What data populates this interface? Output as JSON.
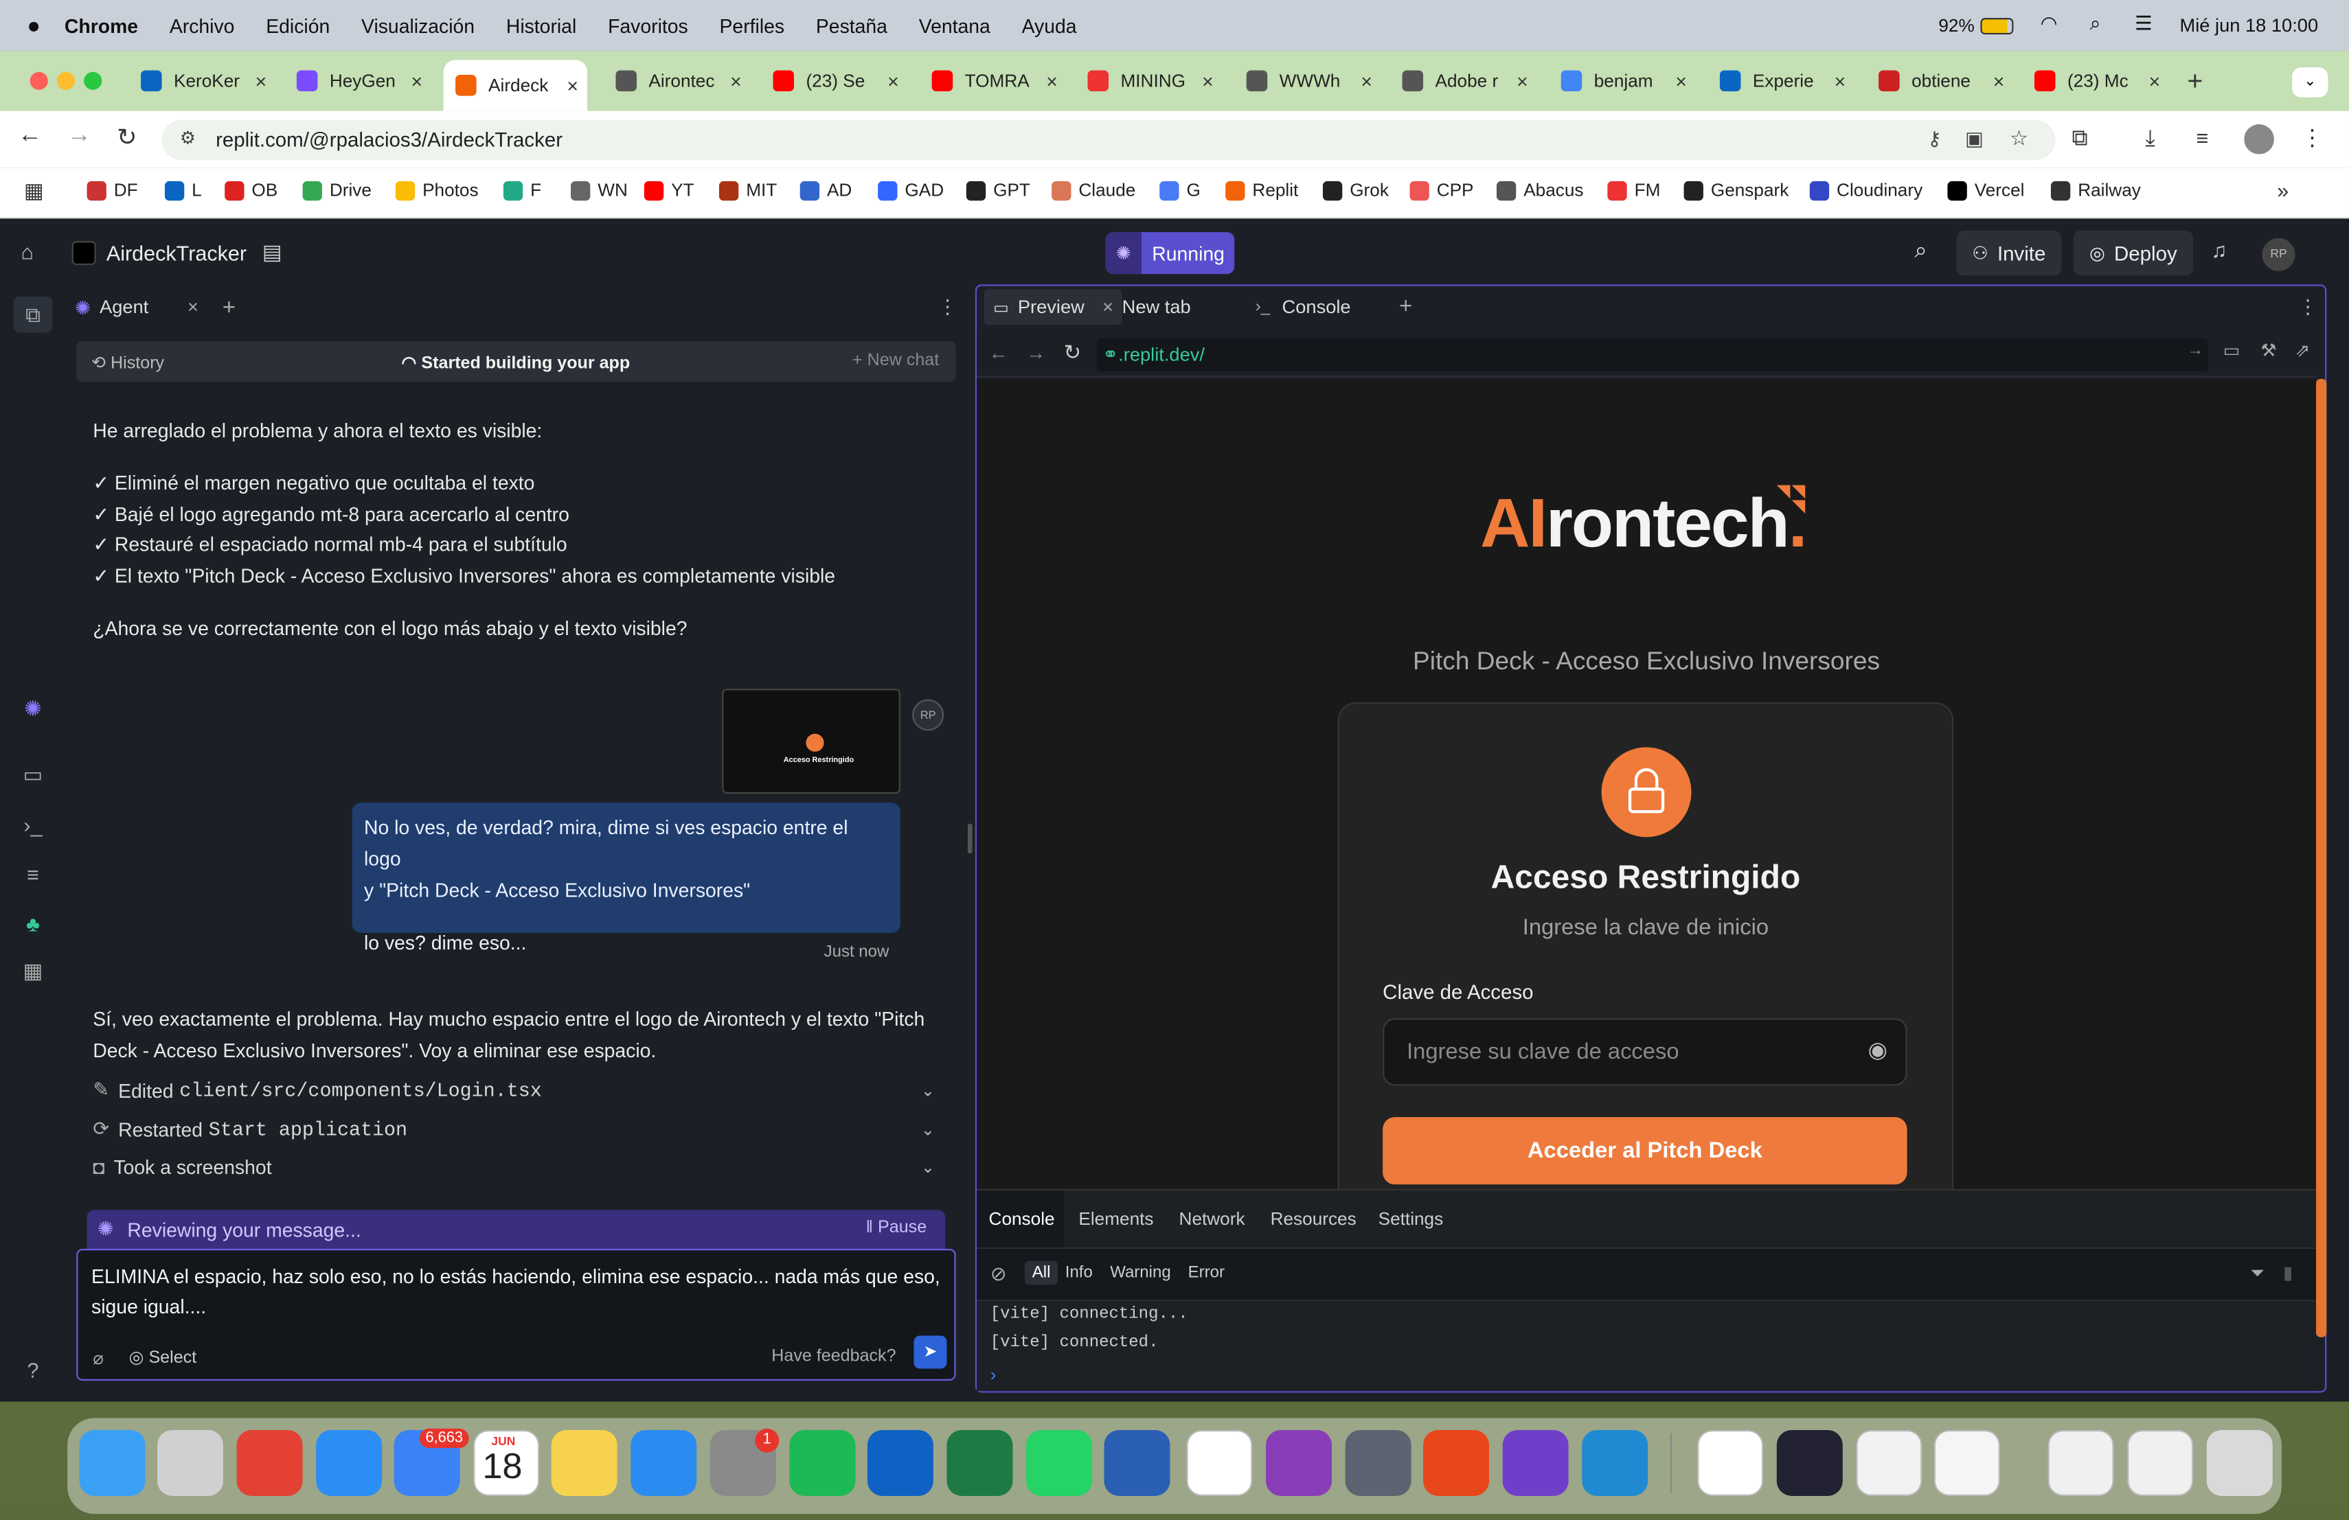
{
  "menubar": {
    "app": "Chrome",
    "items": [
      "Archivo",
      "Edición",
      "Visualización",
      "Historial",
      "Favoritos",
      "Perfiles",
      "Pestaña",
      "Ventana",
      "Ayuda"
    ],
    "battery": "92%",
    "datetime": "Mié jun 18  10:00"
  },
  "tabs": [
    {
      "title": "KeroKer",
      "color": "#0a66c2"
    },
    {
      "title": "HeyGen",
      "color": "#7b4cff"
    },
    {
      "title": "Airdeck",
      "color": "#f26207"
    },
    {
      "title": "Airontec",
      "color": "#555"
    },
    {
      "title": "(23) Se",
      "color": "#ff0000"
    },
    {
      "title": "TOMRA",
      "color": "#ff0000"
    },
    {
      "title": "MINING",
      "color": "#e33"
    },
    {
      "title": "WWWh",
      "color": "#555"
    },
    {
      "title": "Adobe r",
      "color": "#555"
    },
    {
      "title": "benjam",
      "color": "#4285f4"
    },
    {
      "title": "Experie",
      "color": "#0a66c2"
    },
    {
      "title": "obtiene",
      "color": "#c22"
    },
    {
      "title": "(23) Mc",
      "color": "#ff0000"
    }
  ],
  "address": {
    "url": "replit.com/@rpalacios3/AirdeckTracker"
  },
  "bookmarks": [
    {
      "label": "DF",
      "color": "#c33"
    },
    {
      "label": "L",
      "color": "#0a66c2"
    },
    {
      "label": "OB",
      "color": "#d22"
    },
    {
      "label": "Drive",
      "color": "#34a853"
    },
    {
      "label": "Photos",
      "color": "#fbbc05"
    },
    {
      "label": "F",
      "color": "#2a8"
    },
    {
      "label": "WN",
      "color": "#666"
    },
    {
      "label": "YT",
      "color": "#f00"
    },
    {
      "label": "MIT",
      "color": "#a31"
    },
    {
      "label": "AD",
      "color": "#36c"
    },
    {
      "label": "GAD",
      "color": "#36f"
    },
    {
      "label": "GPT",
      "color": "#222"
    },
    {
      "label": "Claude",
      "color": "#d97757"
    },
    {
      "label": "G",
      "color": "#4a7bf7"
    },
    {
      "label": "Replit",
      "color": "#f26207"
    },
    {
      "label": "Grok",
      "color": "#222"
    },
    {
      "label": "CPP",
      "color": "#e55"
    },
    {
      "label": "Abacus",
      "color": "#555"
    },
    {
      "label": "FM",
      "color": "#e33"
    },
    {
      "label": "Genspark",
      "color": "#222"
    },
    {
      "label": "Cloudinary",
      "color": "#3448c5"
    },
    {
      "label": "Vercel",
      "color": "#000"
    },
    {
      "label": "Railway",
      "color": "#333"
    }
  ],
  "replit": {
    "project": "AirdeckTracker",
    "status": "Running",
    "invite": "Invite",
    "deploy": "Deploy",
    "avatar": "RP"
  },
  "agent": {
    "tab": "Agent",
    "history": "History",
    "building": "Started building your app",
    "new_chat": "+ New chat",
    "msg1_intro": "He arreglado el problema y ahora el texto es visible:",
    "msg1_points": [
      "✓ Eliminé el margen negativo que ocultaba el texto",
      "✓ Bajé el logo agregando mt-8 para acercarlo al centro",
      "✓ Restauré el espaciado normal mb-4 para el subtítulo",
      "✓ El texto \"Pitch Deck - Acceso Exclusivo Inversores\" ahora es completamente visible"
    ],
    "msg1_question": "¿Ahora se ve correctamente con el logo más abajo y el texto visible?",
    "thumb_title": "Acceso Restringido",
    "user_line1": "No lo ves, de verdad? mira, dime si ves espacio entre el logo",
    "user_line2": "y \"Pitch Deck - Acceso Exclusivo Inversores\"",
    "user_line3": "lo ves? dime eso...",
    "user_time": "Just now",
    "reply_line1": "Sí, veo exactamente el problema. Hay mucho espacio entre el logo de Airontech y el texto \"Pitch",
    "reply_line2": "Deck - Acceso Exclusivo Inversores\". Voy a eliminar ese espacio.",
    "step1_label": "Edited",
    "step1_file": "client/src/components/Login.tsx",
    "step2_label": "Restarted",
    "step2_cmd": "Start application",
    "step3_label": "Took a screenshot",
    "reviewing": "Reviewing your message...",
    "pause": "Pause",
    "input_line1": "ELIMINA el espacio, haz solo eso, no lo estás haciendo, elimina ese espacio... nada más que eso,",
    "input_line2": "sigue igual....",
    "select": "Select",
    "feedback": "Have feedback?"
  },
  "preview": {
    "tabs": [
      "Preview",
      "New tab",
      "Console"
    ],
    "url": ".replit.dev/",
    "logo_ai": "AI",
    "logo_rest": "rontech",
    "subtitle": "Pitch Deck - Acceso Exclusivo Inversores",
    "card_title": "Acceso Restringido",
    "card_sub": "Ingrese la clave de inicio",
    "field_label": "Clave de Acceso",
    "field_placeholder": "Ingrese su clave de acceso",
    "button": "Acceder al Pitch Deck"
  },
  "devtools": {
    "tabs": [
      "Console",
      "Elements",
      "Network",
      "Resources",
      "Settings"
    ],
    "filters": [
      "All",
      "Info",
      "Warning",
      "Error"
    ],
    "logs": [
      "[vite] connecting...",
      "[vite] connected."
    ]
  },
  "dock": {
    "mail_badge": "6,663",
    "cal_month": "JUN",
    "cal_day": "18",
    "settings_badge": "1"
  },
  "colors": {
    "accent": "#ee7b3d",
    "replit_purple": "#5a4fcf"
  }
}
